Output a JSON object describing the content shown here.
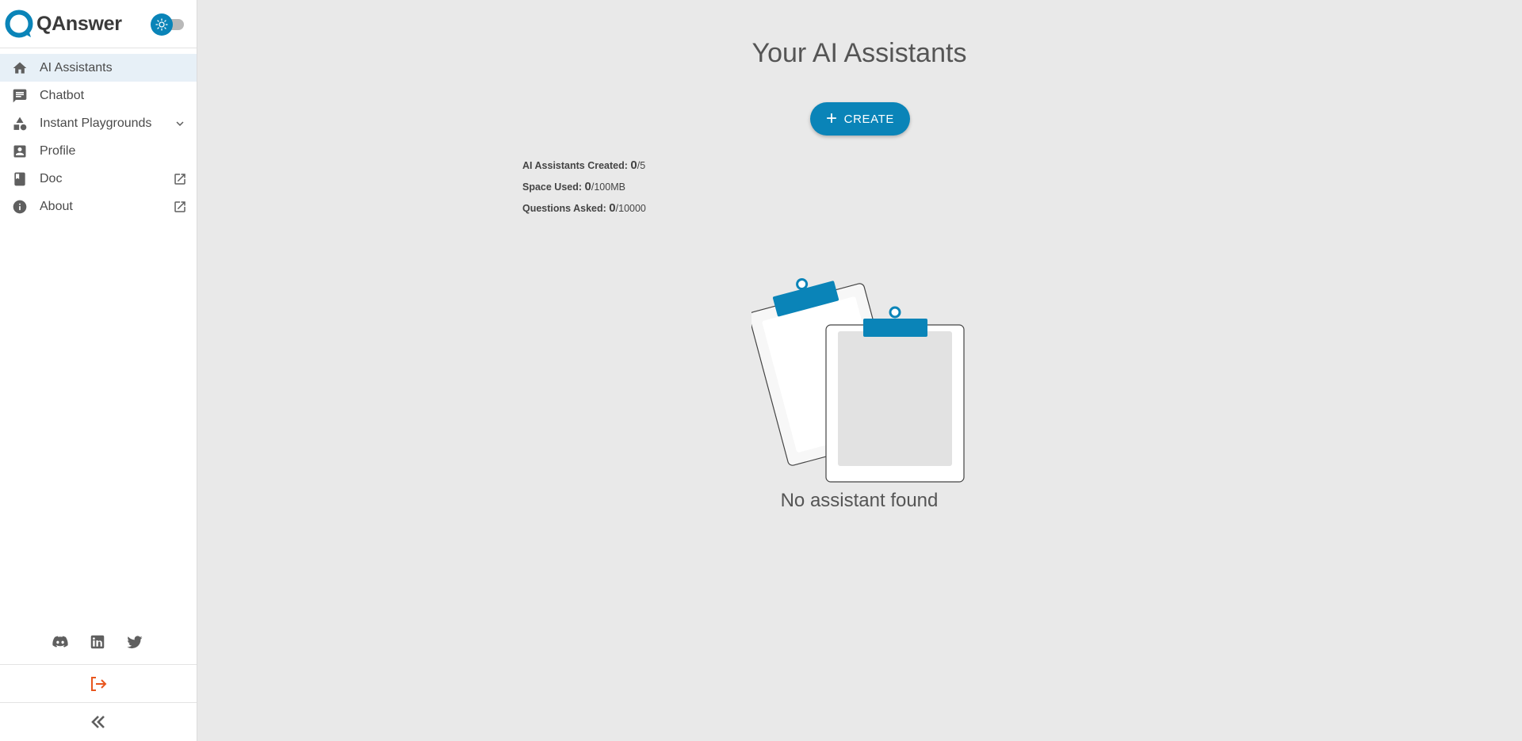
{
  "brand": {
    "name": "QAnswer"
  },
  "theme_toggle": {
    "icon": "sun-icon",
    "state": "light"
  },
  "nav": {
    "items": [
      {
        "label": "AI Assistants",
        "icon": "home-icon",
        "active": true
      },
      {
        "label": "Chatbot",
        "icon": "chat-icon"
      },
      {
        "label": "Instant Playgrounds",
        "icon": "shapes-icon",
        "trailing": "chevron-down-icon"
      },
      {
        "label": "Profile",
        "icon": "profile-icon"
      },
      {
        "label": "Doc",
        "icon": "book-icon",
        "trailing": "external-link-icon"
      },
      {
        "label": "About",
        "icon": "info-icon",
        "trailing": "external-link-icon"
      }
    ]
  },
  "socials": [
    "discord-icon",
    "linkedin-icon",
    "twitter-icon"
  ],
  "footer": {
    "logout_icon": "logout-icon",
    "collapse_icon": "double-chevron-left-icon"
  },
  "main": {
    "title": "Your AI Assistants",
    "create_label": "CREATE",
    "stats": [
      {
        "label": "AI Assistants Created:",
        "value": "0",
        "max": "/5"
      },
      {
        "label": "Space Used:",
        "value": "0",
        "max": "/100MB"
      },
      {
        "label": "Questions Asked:",
        "value": "0",
        "max": "/10000"
      }
    ],
    "empty_text": "No assistant found"
  },
  "colors": {
    "accent": "#0a84b8",
    "logout": "#e8561e",
    "background": "#e9e9e9",
    "sidebar_active": "#e7f0f7"
  }
}
